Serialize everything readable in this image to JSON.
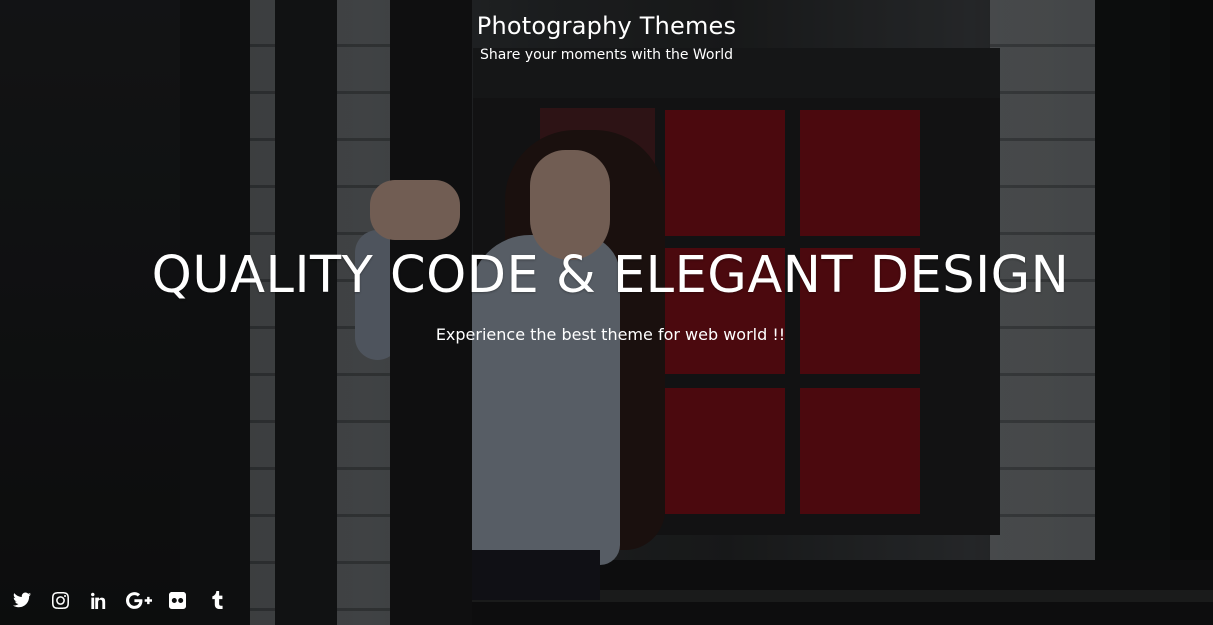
{
  "header": {
    "site_title": "Photography Themes",
    "tagline": "Share your moments with the World"
  },
  "hero": {
    "headline": "QUALITY CODE & ELEGANT DESIGN",
    "subheadline": "Experience the best theme for web world !!"
  },
  "social_links": [
    {
      "icon": "twitter-icon"
    },
    {
      "icon": "instagram-icon"
    },
    {
      "icon": "linkedin-icon"
    },
    {
      "icon": "google-plus-icon"
    },
    {
      "icon": "flickr-icon"
    },
    {
      "icon": "tumblr-icon"
    }
  ],
  "colors": {
    "text": "#ffffff",
    "overlay": "rgba(0,0,0,0.38)"
  }
}
